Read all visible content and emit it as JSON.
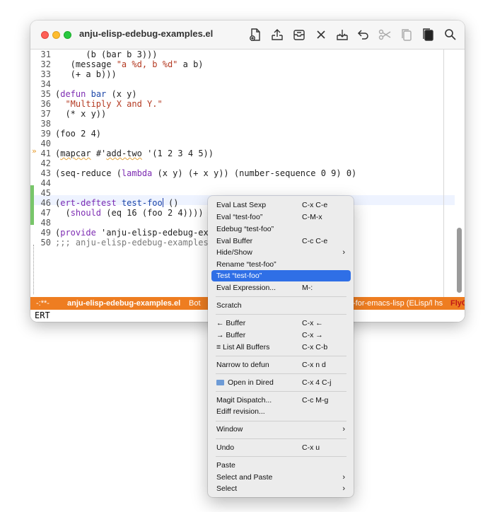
{
  "window": {
    "title": "anju-elisp-edebug-examples.el"
  },
  "toolbar": {
    "icons": [
      "new-file-icon",
      "upload-icon",
      "archive-icon",
      "close-icon",
      "download-icon",
      "undo-icon",
      "cut-icon",
      "copy-icon",
      "paste-icon",
      "search-icon"
    ]
  },
  "editor": {
    "lines": [
      {
        "n": "31",
        "c": "      (b (bar b 3)))"
      },
      {
        "n": "32",
        "c": "   (message \"a %d, b %d\" a b)"
      },
      {
        "n": "33",
        "c": "   (+ a b)))"
      },
      {
        "n": "34",
        "c": ""
      },
      {
        "n": "35",
        "c": "(defun bar (x y)"
      },
      {
        "n": "36",
        "c": "  \"Multiply X and Y.\""
      },
      {
        "n": "37",
        "c": "  (* x y))"
      },
      {
        "n": "38",
        "c": ""
      },
      {
        "n": "39",
        "c": "(foo 2 4)"
      },
      {
        "n": "40",
        "c": ""
      },
      {
        "n": "41",
        "c": "(mapcar #'add-two '(1 2 3 4 5))"
      },
      {
        "n": "42",
        "c": ""
      },
      {
        "n": "43",
        "c": "(seq-reduce (lambda (x y) (+ x y)) (number-sequence 0 9) 0)"
      },
      {
        "n": "44",
        "c": ""
      },
      {
        "n": "45",
        "c": ""
      },
      {
        "n": "46",
        "c": "(ert-deftest test-foo ()"
      },
      {
        "n": "47",
        "c": "  (should (eq 16 (foo 2 4))))"
      },
      {
        "n": "48",
        "c": ""
      },
      {
        "n": "49",
        "c": "(provide 'anju-elisp-edebug-exam"
      },
      {
        "n": "50",
        "c": ";;; anju-elisp-edebug-examples.e"
      }
    ]
  },
  "modeline": {
    "state": "-:**-",
    "buffer": "anju-elisp-edebug-examples.el",
    "position": "Bot",
    "right": "-for-emacs-lisp  (ELisp/l hs",
    "flycheck": "FlyC"
  },
  "echo": {
    "text": "ERT"
  },
  "context_menu": {
    "items": [
      {
        "label": "Eval Last Sexp",
        "key": "C-x C-e"
      },
      {
        "label": "Eval “test-foo”",
        "key": "C-M-x"
      },
      {
        "label": "Edebug “test-foo”",
        "key": ""
      },
      {
        "label": "Eval Buffer",
        "key": "C-c C-e"
      },
      {
        "label": "Hide/Show",
        "key": "",
        "arrow": "›"
      },
      {
        "label": "Rename “test-foo”",
        "key": ""
      },
      {
        "label": "Test “test-foo”",
        "key": ""
      },
      {
        "label": "Eval Expression...",
        "key": "M-:"
      },
      {
        "label": "Scratch",
        "key": ""
      },
      {
        "label": "← Buffer",
        "key": "C-x ←"
      },
      {
        "label": "→ Buffer",
        "key": "C-x →"
      },
      {
        "label": "≡ List All Buffers",
        "key": "C-x C-b"
      },
      {
        "label": "Narrow to defun",
        "key": "C-x n d"
      },
      {
        "label": "Open in Dired",
        "key": "C-x 4 C-j"
      },
      {
        "label": "Magit Dispatch...",
        "key": "C-c M-g"
      },
      {
        "label": "Ediff revision...",
        "key": ""
      },
      {
        "label": "Window",
        "key": "",
        "arrow": "›"
      },
      {
        "label": "Undo",
        "key": "C-x u"
      },
      {
        "label": "Paste",
        "key": ""
      },
      {
        "label": "Select and Paste",
        "key": "",
        "arrow": "›"
      },
      {
        "label": "Select",
        "key": "",
        "arrow": "›"
      }
    ]
  }
}
